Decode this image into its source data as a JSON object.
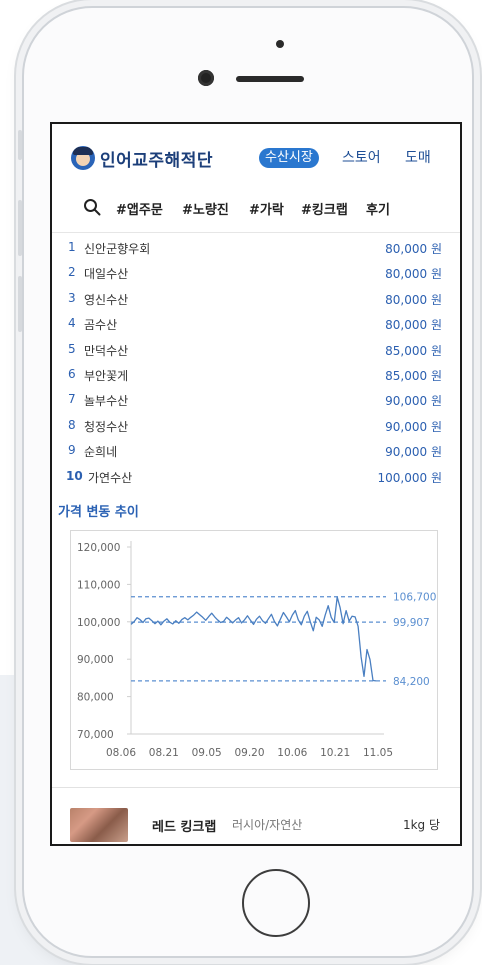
{
  "header": {
    "brand": "인어교주해적단",
    "nav": {
      "market": "수산시장",
      "store": "스토어",
      "wholesale": "도매"
    }
  },
  "tags": [
    "#앱주문",
    "#노량진",
    "#가락",
    "#킹크랩",
    "후기"
  ],
  "ranking": [
    {
      "rank": "1",
      "name": "신안군향우회",
      "price": "80,000 원"
    },
    {
      "rank": "2",
      "name": "대일수산",
      "price": "80,000 원"
    },
    {
      "rank": "3",
      "name": "영신수산",
      "price": "80,000 원"
    },
    {
      "rank": "4",
      "name": "곰수산",
      "price": "80,000 원"
    },
    {
      "rank": "5",
      "name": "만덕수산",
      "price": "85,000 원"
    },
    {
      "rank": "6",
      "name": "부안꽃게",
      "price": "85,000 원"
    },
    {
      "rank": "7",
      "name": "놀부수산",
      "price": "90,000 원"
    },
    {
      "rank": "8",
      "name": "청정수산",
      "price": "90,000 원"
    },
    {
      "rank": "9",
      "name": "순희네",
      "price": "90,000 원"
    },
    {
      "rank": "10",
      "name": "가연수산",
      "price": "100,000 원"
    }
  ],
  "chart_section_title": "가격 변동 추이",
  "chart_data": {
    "type": "line",
    "title": "",
    "xlabel": "",
    "ylabel": "",
    "x_ticks": [
      "08.06",
      "08.21",
      "09.05",
      "09.20",
      "10.06",
      "10.21",
      "11.05"
    ],
    "y_ticks": [
      "120,000",
      "110,000",
      "100,000",
      "90,000",
      "80,000",
      "70,000"
    ],
    "y_tick_values": [
      120000,
      110000,
      100000,
      90000,
      80000,
      70000
    ],
    "ylim": [
      70000,
      120000
    ],
    "grid": false,
    "reference_lines": [
      {
        "label": "106,700",
        "value": 106700
      },
      {
        "label": "99,907",
        "value": 99907
      },
      {
        "label": "84,200",
        "value": 84200
      }
    ],
    "series": [
      {
        "values": [
          99300,
          100000,
          101100,
          100600,
          99800,
          100800,
          101000,
          100300,
          99500,
          100200,
          99200,
          100200,
          100800,
          99900,
          99400,
          100300,
          99600,
          100600,
          101100,
          100500,
          101200,
          101800,
          102600,
          101900,
          101200,
          100400,
          101400,
          102300,
          101300,
          100500,
          99800,
          100100,
          101200,
          100500,
          99700,
          100500,
          101100,
          99700,
          100500,
          101600,
          100400,
          99300,
          100700,
          101500,
          100300,
          99600,
          100800,
          102000,
          100100,
          98900,
          100700,
          102500,
          101300,
          100000,
          101800,
          103000,
          100500,
          99200,
          101500,
          102800,
          100000,
          97600,
          101200,
          100500,
          98800,
          101800,
          104300,
          101200,
          99800,
          106600,
          103800,
          99500,
          103000,
          100200,
          101500,
          101300,
          98800,
          90600,
          85400,
          92600,
          89900,
          84300,
          84200
        ]
      }
    ],
    "line_color": "#4a7fc1",
    "ref_line_color": "#5b8fd0"
  },
  "product": {
    "name": "레드 킹크랩",
    "origin": "러시아/자연산",
    "unit": "1kg 당"
  }
}
